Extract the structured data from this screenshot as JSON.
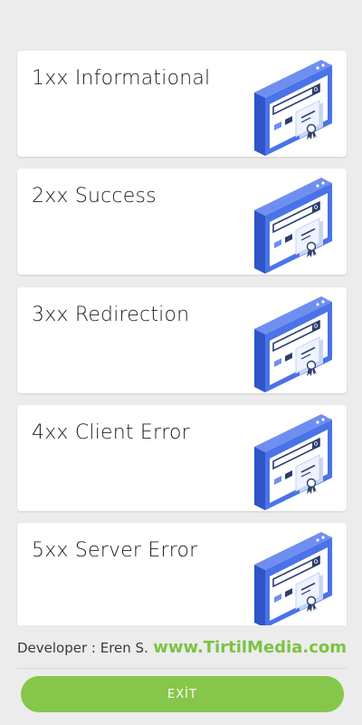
{
  "cards": [
    {
      "label": "1xx Informational",
      "icon": "certificate-window-icon"
    },
    {
      "label": "2xx Success",
      "icon": "certificate-window-icon"
    },
    {
      "label": "3xx Redirection",
      "icon": "certificate-window-icon"
    },
    {
      "label": "4xx Client Error",
      "icon": "certificate-window-icon"
    },
    {
      "label": "5xx Server Error",
      "icon": "certificate-window-icon"
    }
  ],
  "footer": {
    "developer": "Developer : Eren S.",
    "website": "www.TirtilMedia.com"
  },
  "exit_label": "EXİT",
  "colors": {
    "accent_green": "#86c64a",
    "link_green": "#7cc243",
    "illustration_blue": "#4a73e8"
  }
}
